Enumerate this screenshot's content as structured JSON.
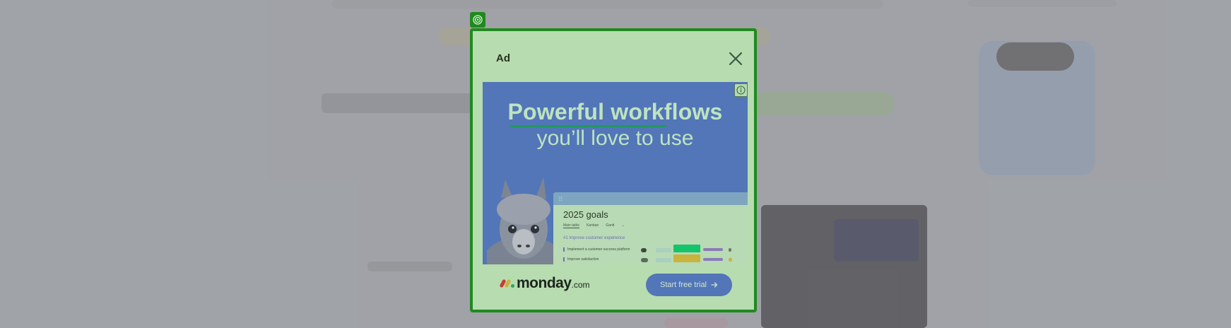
{
  "ad": {
    "label": "Ad",
    "close_icon": "close-icon",
    "adchoices_icon": "adchoices-icon",
    "info_icon": "info-icon",
    "colors": {
      "frame": "#1f8a1f",
      "panel": "#b7dcb0",
      "creative_bg": "#5276b8"
    }
  },
  "creative": {
    "headline_bold": "Powerful workflows",
    "headline_light": "you’ll love to use",
    "board": {
      "title": "2025 goals",
      "tabs": [
        "Main table",
        "Kanban",
        "Gantt",
        "⌄"
      ],
      "group": "#1 Improve customer experience",
      "rows": [
        "Implement a customer success platform",
        "Improve satisfaction"
      ]
    },
    "brand": {
      "name": "monday",
      "suffix": ".com"
    },
    "cta_label": "Start free trial",
    "cta_icon": "arrow-right-icon"
  }
}
